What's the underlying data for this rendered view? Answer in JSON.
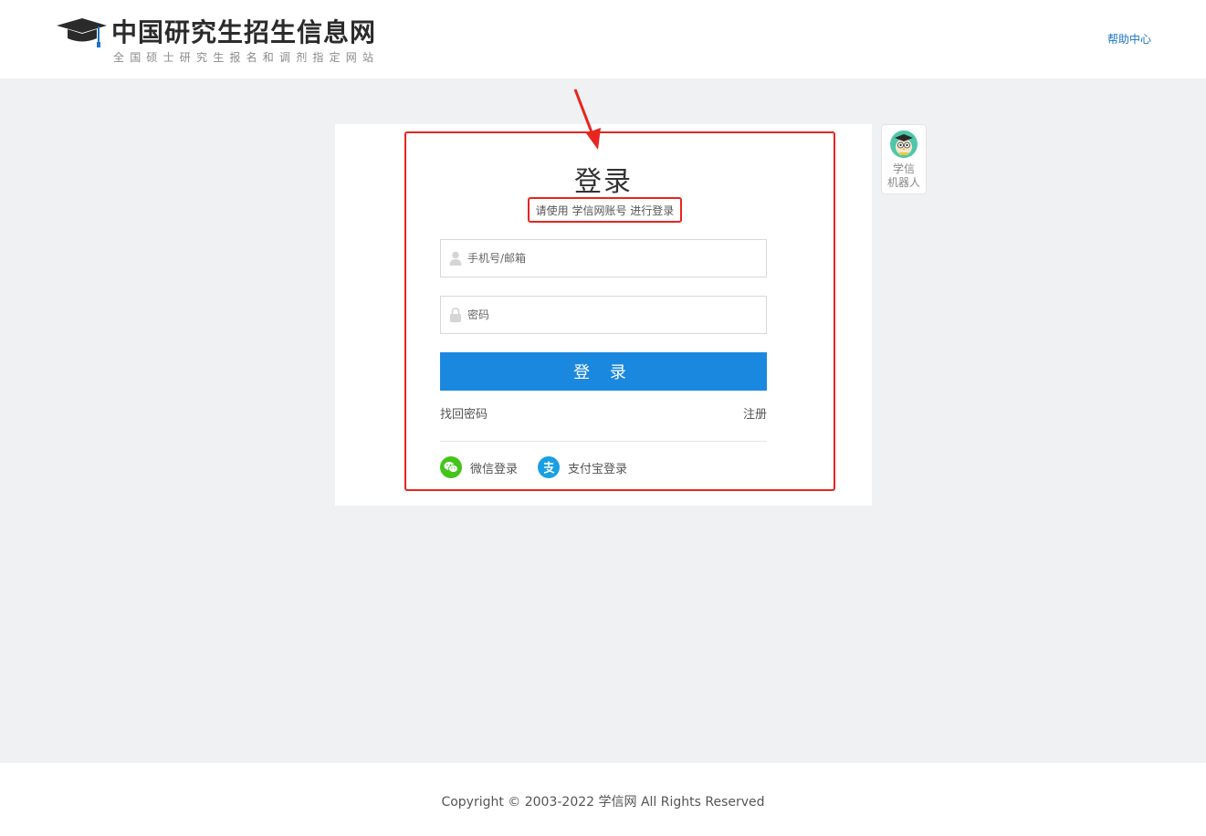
{
  "header": {
    "logo_title": "中国研究生招生信息网",
    "logo_subtitle": "全国硕士研究生报名和调剂指定网站",
    "help_link": "帮助中心"
  },
  "login": {
    "title": "登录",
    "subtitle": "请使用 学信网账号 进行登录",
    "username_placeholder": "手机号/邮箱",
    "password_placeholder": "密码",
    "submit_label": "登 录",
    "forgot_password": "找回密码",
    "register": "注册",
    "social": [
      {
        "label": "微信登录",
        "icon": "wechat-icon",
        "color": "#43c51a"
      },
      {
        "label": "支付宝登录",
        "icon": "alipay-icon",
        "color": "#1a9fe3"
      }
    ]
  },
  "robot": {
    "line1": "学信",
    "line2": "机器人"
  },
  "footer": {
    "copyright": "Copyright © 2003-2022 学信网 All Rights Reserved"
  },
  "colors": {
    "accent": "#1b88e0",
    "highlight": "#e8251f",
    "link": "#1a73c8"
  }
}
